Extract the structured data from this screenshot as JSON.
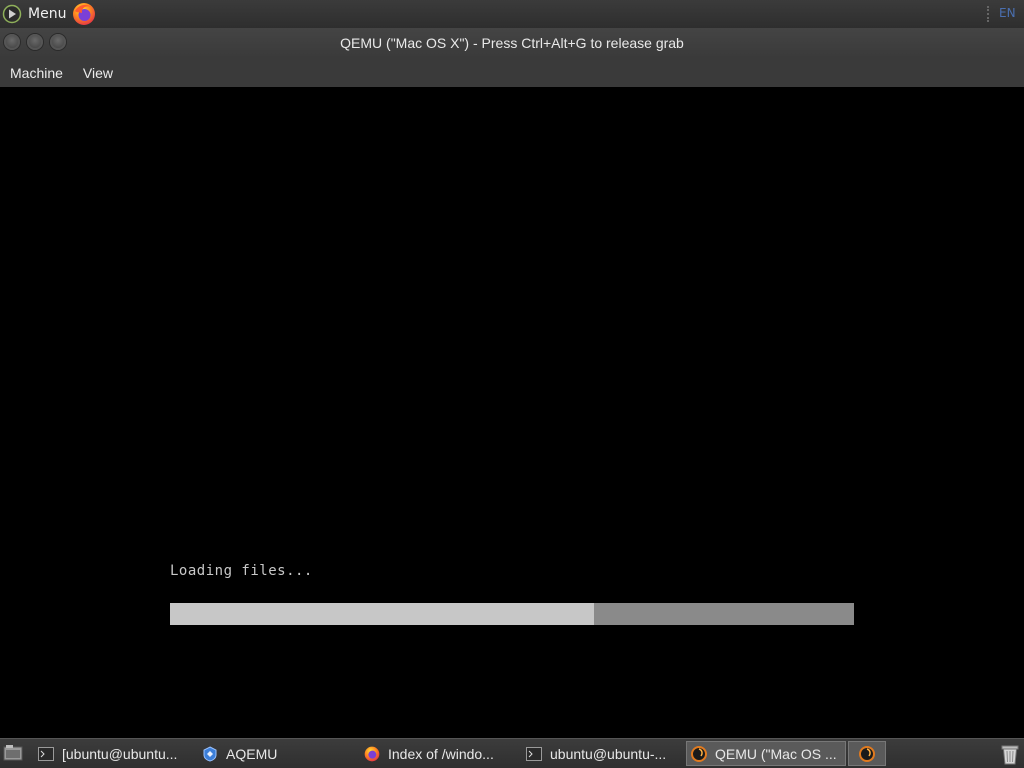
{
  "top_panel": {
    "menu_label": "Menu",
    "menu_icon": "mint-menu-icon",
    "launcher_icon": "firefox-icon",
    "keyboard_layout": "EN"
  },
  "window": {
    "title": "QEMU (\"Mac OS X\") - Press Ctrl+Alt+G to release grab",
    "buttons": [
      "close-icon",
      "minimize-icon",
      "maximize-icon"
    ]
  },
  "menubar": {
    "items": [
      "Machine",
      "View"
    ]
  },
  "guest_screen": {
    "status_text": "Loading files...",
    "progress": 0.62,
    "colors": {
      "fill": "#c7c7c7",
      "track": "#8a8a8a",
      "background": "#000000"
    }
  },
  "taskbar": {
    "tasks": [
      {
        "label": "[ubuntu@ubuntu...",
        "icon": "terminal-icon",
        "active": false
      },
      {
        "label": "AQEMU",
        "icon": "aqemu-icon",
        "active": false
      },
      {
        "label": "Index of /windo...",
        "icon": "firefox-icon",
        "active": false
      },
      {
        "label": "ubuntu@ubuntu-...",
        "icon": "terminal-icon",
        "active": false
      },
      {
        "label": "QEMU (\"Mac OS ...",
        "icon": "qemu-icon",
        "active": true
      },
      {
        "label": "",
        "icon": "qemu-icon",
        "active": false
      }
    ],
    "trash_icon": "trash-icon"
  }
}
